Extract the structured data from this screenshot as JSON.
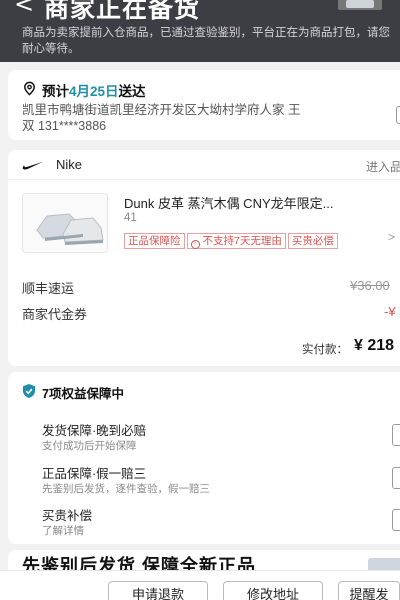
{
  "header": {
    "back_icon": "chevron-left-icon",
    "title": "商家正在备货",
    "description": "商品为卖家提前入仓商品，已通过查验鉴别，平台正在为商品打包，请您耐心等待。"
  },
  "address": {
    "eta_prefix": "预计",
    "eta_date": "4月25日",
    "eta_suffix": "送达",
    "line1": "凯里市鸭塘街道凯里经济开发区大坳村学府人家 王",
    "line2": "双 131****3886",
    "icon": "location-pin-icon"
  },
  "order": {
    "brand": "Nike",
    "store_link": "进入品",
    "product_name": "Dunk 皮革 蒸汽木偶 CNY龙年限定...",
    "product_size": "41",
    "tags": [
      "正品保障险",
      "不支持7天无理由",
      "买贵必偿"
    ],
    "shipping_label": "顺丰速运",
    "shipping_amount": "¥36.00",
    "voucher_label": "商家代金券",
    "voucher_amount": "-¥",
    "paid_label": "实付款：",
    "paid_amount": "¥ 218"
  },
  "rights": {
    "title": "7项权益保障中",
    "items": [
      {
        "title": "发货保障·晚到必赔",
        "sub": "支付成功后开始保障"
      },
      {
        "title": "正品保障·假一赔三",
        "sub": "先鉴别后发货，逐件查验，假一赔三"
      },
      {
        "title": "买贵补偿",
        "sub": "了解详情"
      }
    ]
  },
  "banner": {
    "text": "先鉴别后发货 保障全新正品"
  },
  "bottom_bar": {
    "buttons": [
      "申请退款",
      "修改地址",
      "提醒发"
    ]
  },
  "colors": {
    "header_bg": "#3d3d44",
    "accent_teal": "#1f8fa8",
    "tag_red": "#d9534f"
  }
}
